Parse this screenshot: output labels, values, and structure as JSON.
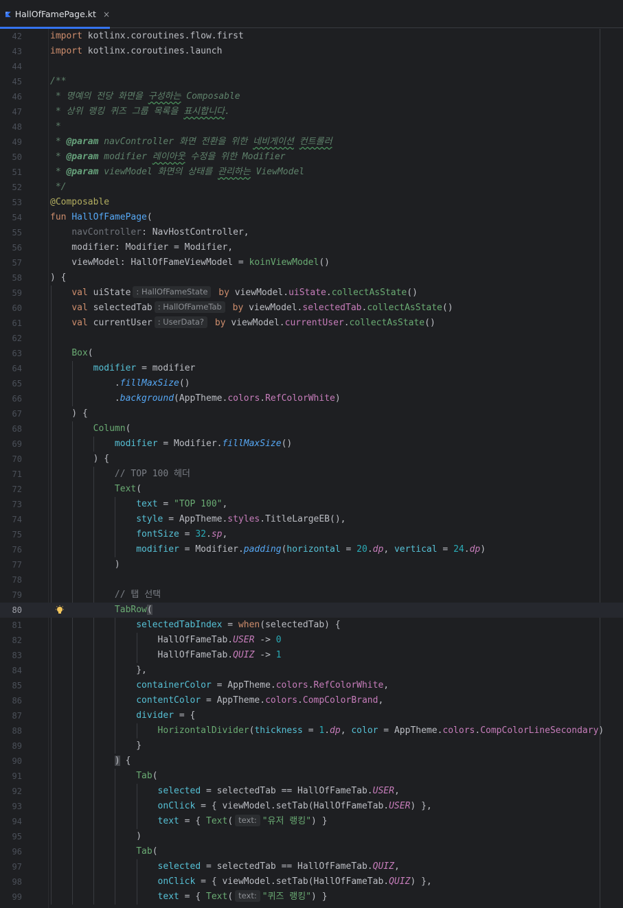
{
  "tab": {
    "filename": "HallOfFamePage.kt",
    "close_glyph": "×",
    "icon": "kotlin-icon"
  },
  "colors": {
    "accent": "#3574f0",
    "background": "#1e1f22",
    "current_line": "#26282e"
  },
  "current_line": 80,
  "lines": [
    {
      "n": "42",
      "parts": [
        [
          "kw",
          "import "
        ],
        [
          "",
          "kotlinx.coroutines.flow.first"
        ]
      ]
    },
    {
      "n": "43",
      "parts": [
        [
          "kw",
          "import "
        ],
        [
          "",
          "kotlinx.coroutines.launch"
        ]
      ]
    },
    {
      "n": "44",
      "parts": []
    },
    {
      "n": "45",
      "parts": [
        [
          "doc",
          "/**"
        ]
      ]
    },
    {
      "n": "46",
      "parts": [
        [
          "doc",
          " * 명예의 전당 화면을 "
        ],
        [
          "doc typo",
          "구성하는"
        ],
        [
          "doc",
          " Composable"
        ]
      ]
    },
    {
      "n": "47",
      "parts": [
        [
          "doc",
          " * 상위 랭킹 퀴즈 그룹 목록을 "
        ],
        [
          "doc typo",
          "표시합니다"
        ],
        [
          "doc",
          "."
        ]
      ]
    },
    {
      "n": "48",
      "parts": [
        [
          "doc",
          " *"
        ]
      ]
    },
    {
      "n": "49",
      "parts": [
        [
          "doc",
          " * "
        ],
        [
          "tag",
          "@param"
        ],
        [
          "doc",
          " "
        ],
        [
          "doc param-doc",
          "navController"
        ],
        [
          "doc",
          " 화면 전환을 위한 "
        ],
        [
          "doc typo",
          "네비게이션"
        ],
        [
          "doc",
          " "
        ],
        [
          "doc typo",
          "컨트롤러"
        ]
      ]
    },
    {
      "n": "50",
      "parts": [
        [
          "doc",
          " * "
        ],
        [
          "tag",
          "@param"
        ],
        [
          "doc",
          " "
        ],
        [
          "doc param-doc",
          "modifier"
        ],
        [
          "doc",
          " "
        ],
        [
          "doc typo",
          "레이아웃"
        ],
        [
          "doc",
          " 수정을 위한 Modifier"
        ]
      ]
    },
    {
      "n": "51",
      "parts": [
        [
          "doc",
          " * "
        ],
        [
          "tag",
          "@param"
        ],
        [
          "doc",
          " "
        ],
        [
          "doc param-doc",
          "viewModel"
        ],
        [
          "doc",
          " 화면의 상태를 "
        ],
        [
          "doc typo",
          "관리하는"
        ],
        [
          "doc",
          " ViewModel"
        ]
      ]
    },
    {
      "n": "52",
      "parts": [
        [
          "doc",
          " */"
        ]
      ]
    },
    {
      "n": "53",
      "parts": [
        [
          "ann",
          "@Composable"
        ]
      ]
    },
    {
      "n": "54",
      "parts": [
        [
          "kw",
          "fun "
        ],
        [
          "fn",
          "HallOfFamePage"
        ],
        [
          "",
          "("
        ]
      ]
    },
    {
      "n": "55",
      "parts": [
        [
          "",
          "    "
        ],
        [
          "gray",
          "navController"
        ],
        [
          "",
          ": NavHostController,"
        ]
      ]
    },
    {
      "n": "56",
      "parts": [
        [
          "",
          "    modifier: Modifier = Modifier,"
        ]
      ]
    },
    {
      "n": "57",
      "parts": [
        [
          "",
          "    viewModel: HallOfFameViewModel = "
        ],
        [
          "str",
          "koinViewModel"
        ],
        [
          "",
          "()"
        ]
      ]
    },
    {
      "n": "58",
      "parts": [
        [
          "",
          ") {"
        ]
      ]
    },
    {
      "n": "59",
      "parts": [
        [
          "",
          "    "
        ],
        [
          "kw",
          "val "
        ],
        [
          "",
          "uiState"
        ],
        [
          "hint",
          ": HallOfFameState"
        ],
        [
          "kw",
          " by "
        ],
        [
          "",
          "viewModel."
        ],
        [
          "prop",
          "uiState"
        ],
        [
          "",
          "."
        ],
        [
          "str",
          "collectAsState"
        ],
        [
          "",
          "()"
        ]
      ]
    },
    {
      "n": "60",
      "parts": [
        [
          "",
          "    "
        ],
        [
          "kw",
          "val "
        ],
        [
          "",
          "selectedTab"
        ],
        [
          "hint",
          ": HallOfFameTab"
        ],
        [
          "kw",
          " by "
        ],
        [
          "",
          "viewModel."
        ],
        [
          "prop",
          "selectedTab"
        ],
        [
          "",
          "."
        ],
        [
          "str",
          "collectAsState"
        ],
        [
          "",
          "()"
        ]
      ]
    },
    {
      "n": "61",
      "parts": [
        [
          "",
          "    "
        ],
        [
          "kw",
          "val "
        ],
        [
          "",
          "currentUser"
        ],
        [
          "hint",
          ": UserData?"
        ],
        [
          "kw",
          " by "
        ],
        [
          "",
          "viewModel."
        ],
        [
          "prop",
          "currentUser"
        ],
        [
          "",
          "."
        ],
        [
          "str",
          "collectAsState"
        ],
        [
          "",
          "()"
        ]
      ]
    },
    {
      "n": "62",
      "parts": []
    },
    {
      "n": "63",
      "parts": [
        [
          "",
          "    "
        ],
        [
          "str",
          "Box"
        ],
        [
          "",
          "("
        ]
      ]
    },
    {
      "n": "64",
      "parts": [
        [
          "",
          "        "
        ],
        [
          "named",
          "modifier"
        ],
        [
          "",
          " = modifier"
        ]
      ]
    },
    {
      "n": "65",
      "parts": [
        [
          "",
          "            ."
        ],
        [
          "ext",
          "fillMaxSize"
        ],
        [
          "",
          "()"
        ]
      ]
    },
    {
      "n": "66",
      "parts": [
        [
          "",
          "            ."
        ],
        [
          "ext",
          "background"
        ],
        [
          "",
          "(AppTheme."
        ],
        [
          "prop",
          "colors"
        ],
        [
          "",
          "."
        ],
        [
          "prop",
          "RefColorWhite"
        ],
        [
          "",
          ")"
        ]
      ]
    },
    {
      "n": "67",
      "parts": [
        [
          "",
          "    ) {"
        ]
      ]
    },
    {
      "n": "68",
      "parts": [
        [
          "",
          "        "
        ],
        [
          "str",
          "Column"
        ],
        [
          "",
          "("
        ]
      ]
    },
    {
      "n": "69",
      "parts": [
        [
          "",
          "            "
        ],
        [
          "named",
          "modifier"
        ],
        [
          "",
          " = Modifier."
        ],
        [
          "ext",
          "fillMaxSize"
        ],
        [
          "",
          "()"
        ]
      ]
    },
    {
      "n": "70",
      "parts": [
        [
          "",
          "        ) {"
        ]
      ]
    },
    {
      "n": "71",
      "parts": [
        [
          "",
          "            "
        ],
        [
          "cm",
          "// TOP 100 헤더"
        ]
      ]
    },
    {
      "n": "72",
      "parts": [
        [
          "",
          "            "
        ],
        [
          "str",
          "Text"
        ],
        [
          "",
          "("
        ]
      ]
    },
    {
      "n": "73",
      "parts": [
        [
          "",
          "                "
        ],
        [
          "named",
          "text"
        ],
        [
          "",
          " = "
        ],
        [
          "str",
          "\"TOP 100\""
        ],
        [
          "",
          ","
        ]
      ]
    },
    {
      "n": "74",
      "parts": [
        [
          "",
          "                "
        ],
        [
          "named",
          "style"
        ],
        [
          "",
          " = AppTheme."
        ],
        [
          "prop",
          "styles"
        ],
        [
          "",
          ".TitleLargeEB(),"
        ]
      ]
    },
    {
      "n": "75",
      "parts": [
        [
          "",
          "                "
        ],
        [
          "named",
          "fontSize"
        ],
        [
          "",
          " = "
        ],
        [
          "num",
          "32"
        ],
        [
          "",
          "."
        ],
        [
          "ital",
          "sp"
        ],
        [
          "",
          ","
        ]
      ]
    },
    {
      "n": "76",
      "parts": [
        [
          "",
          "                "
        ],
        [
          "named",
          "modifier"
        ],
        [
          "",
          " = Modifier."
        ],
        [
          "ext",
          "padding"
        ],
        [
          "",
          "("
        ],
        [
          "named",
          "horizontal"
        ],
        [
          "",
          " = "
        ],
        [
          "num",
          "20"
        ],
        [
          "",
          "."
        ],
        [
          "ital",
          "dp"
        ],
        [
          "",
          ", "
        ],
        [
          "named",
          "vertical"
        ],
        [
          "",
          " = "
        ],
        [
          "num",
          "24"
        ],
        [
          "",
          "."
        ],
        [
          "ital",
          "dp"
        ],
        [
          "",
          ")"
        ]
      ]
    },
    {
      "n": "77",
      "parts": [
        [
          "",
          "            )"
        ]
      ]
    },
    {
      "n": "78",
      "parts": []
    },
    {
      "n": "79",
      "parts": [
        [
          "",
          "            "
        ],
        [
          "cm",
          "// 탭 선택"
        ]
      ]
    },
    {
      "n": "80",
      "parts": [
        [
          "",
          "            "
        ],
        [
          "str",
          "TabRow"
        ],
        [
          "match",
          "("
        ]
      ]
    },
    {
      "n": "81",
      "parts": [
        [
          "",
          "                "
        ],
        [
          "named",
          "selectedTabIndex"
        ],
        [
          "",
          " = "
        ],
        [
          "kw",
          "when"
        ],
        [
          "",
          "(selectedTab) {"
        ]
      ]
    },
    {
      "n": "82",
      "parts": [
        [
          "",
          "                    HallOfFameTab."
        ],
        [
          "ital",
          "USER"
        ],
        [
          "",
          " -> "
        ],
        [
          "num",
          "0"
        ]
      ]
    },
    {
      "n": "83",
      "parts": [
        [
          "",
          "                    HallOfFameTab."
        ],
        [
          "ital",
          "QUIZ"
        ],
        [
          "",
          " -> "
        ],
        [
          "num",
          "1"
        ]
      ]
    },
    {
      "n": "84",
      "parts": [
        [
          "",
          "                },"
        ]
      ]
    },
    {
      "n": "85",
      "parts": [
        [
          "",
          "                "
        ],
        [
          "named",
          "containerColor"
        ],
        [
          "",
          " = AppTheme."
        ],
        [
          "prop",
          "colors"
        ],
        [
          "",
          "."
        ],
        [
          "prop",
          "RefColorWhite"
        ],
        [
          "",
          ","
        ]
      ]
    },
    {
      "n": "86",
      "parts": [
        [
          "",
          "                "
        ],
        [
          "named",
          "contentColor"
        ],
        [
          "",
          " = AppTheme."
        ],
        [
          "prop",
          "colors"
        ],
        [
          "",
          "."
        ],
        [
          "prop",
          "CompColorBrand"
        ],
        [
          "",
          ","
        ]
      ]
    },
    {
      "n": "87",
      "parts": [
        [
          "",
          "                "
        ],
        [
          "named",
          "divider"
        ],
        [
          "",
          " = {"
        ]
      ]
    },
    {
      "n": "88",
      "parts": [
        [
          "",
          "                    "
        ],
        [
          "str",
          "HorizontalDivider"
        ],
        [
          "",
          "("
        ],
        [
          "named",
          "thickness"
        ],
        [
          "",
          " = "
        ],
        [
          "num",
          "1"
        ],
        [
          "",
          "."
        ],
        [
          "ital",
          "dp"
        ],
        [
          "",
          ", "
        ],
        [
          "named",
          "color"
        ],
        [
          "",
          " = AppTheme."
        ],
        [
          "prop",
          "colors"
        ],
        [
          "",
          "."
        ],
        [
          "prop",
          "CompColorLineSecondary"
        ],
        [
          "",
          ")"
        ]
      ]
    },
    {
      "n": "89",
      "parts": [
        [
          "",
          "                }"
        ]
      ]
    },
    {
      "n": "90",
      "parts": [
        [
          "",
          "            "
        ],
        [
          "match",
          ")"
        ],
        [
          "",
          " {"
        ]
      ]
    },
    {
      "n": "91",
      "parts": [
        [
          "",
          "                "
        ],
        [
          "str",
          "Tab"
        ],
        [
          "",
          "("
        ]
      ]
    },
    {
      "n": "92",
      "parts": [
        [
          "",
          "                    "
        ],
        [
          "named",
          "selected"
        ],
        [
          "",
          " = selectedTab == HallOfFameTab."
        ],
        [
          "ital",
          "USER"
        ],
        [
          "",
          ","
        ]
      ]
    },
    {
      "n": "93",
      "parts": [
        [
          "",
          "                    "
        ],
        [
          "named",
          "onClick"
        ],
        [
          "",
          " = { viewModel.setTab(HallOfFameTab."
        ],
        [
          "ital",
          "USER"
        ],
        [
          "",
          ") },"
        ]
      ]
    },
    {
      "n": "94",
      "parts": [
        [
          "",
          "                    "
        ],
        [
          "named",
          "text"
        ],
        [
          "",
          " = { "
        ],
        [
          "str",
          "Text"
        ],
        [
          "",
          "("
        ],
        [
          "hint",
          "text:"
        ],
        [
          "str",
          "\"유저 랭킹\""
        ],
        [
          "",
          ") }"
        ]
      ]
    },
    {
      "n": "95",
      "parts": [
        [
          "",
          "                )"
        ]
      ]
    },
    {
      "n": "96",
      "parts": [
        [
          "",
          "                "
        ],
        [
          "str",
          "Tab"
        ],
        [
          "",
          "("
        ]
      ]
    },
    {
      "n": "97",
      "parts": [
        [
          "",
          "                    "
        ],
        [
          "named",
          "selected"
        ],
        [
          "",
          " = selectedTab == HallOfFameTab."
        ],
        [
          "ital",
          "QUIZ"
        ],
        [
          "",
          ","
        ]
      ]
    },
    {
      "n": "98",
      "parts": [
        [
          "",
          "                    "
        ],
        [
          "named",
          "onClick"
        ],
        [
          "",
          " = { viewModel.setTab(HallOfFameTab."
        ],
        [
          "ital",
          "QUIZ"
        ],
        [
          "",
          ") },"
        ]
      ]
    },
    {
      "n": "99",
      "parts": [
        [
          "",
          "                    "
        ],
        [
          "named",
          "text"
        ],
        [
          "",
          " = { "
        ],
        [
          "str",
          "Text"
        ],
        [
          "",
          "("
        ],
        [
          "hint",
          "text:"
        ],
        [
          "str",
          "\"퀴즈 랭킹\""
        ],
        [
          "",
          ") }"
        ]
      ]
    }
  ]
}
